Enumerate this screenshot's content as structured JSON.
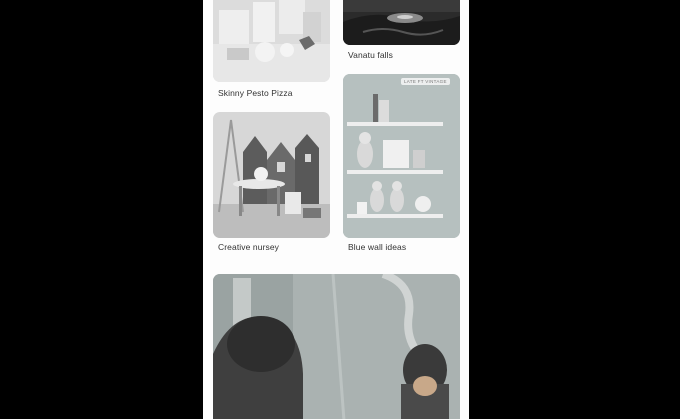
{
  "feed": {
    "pins": [
      {
        "title": "Skinny Pesto Pizza",
        "image_alt": "white-decor-scene"
      },
      {
        "title": "Vanatu falls",
        "image_alt": "waterfall-scene"
      },
      {
        "title": "Creative nursey",
        "image_alt": "nursery-scene"
      },
      {
        "title": "Blue wall ideas",
        "image_alt": "shelves-scene",
        "badge": "LATE FT VINTAGE"
      },
      {
        "title": "",
        "image_alt": "mother-child-scene"
      }
    ]
  }
}
